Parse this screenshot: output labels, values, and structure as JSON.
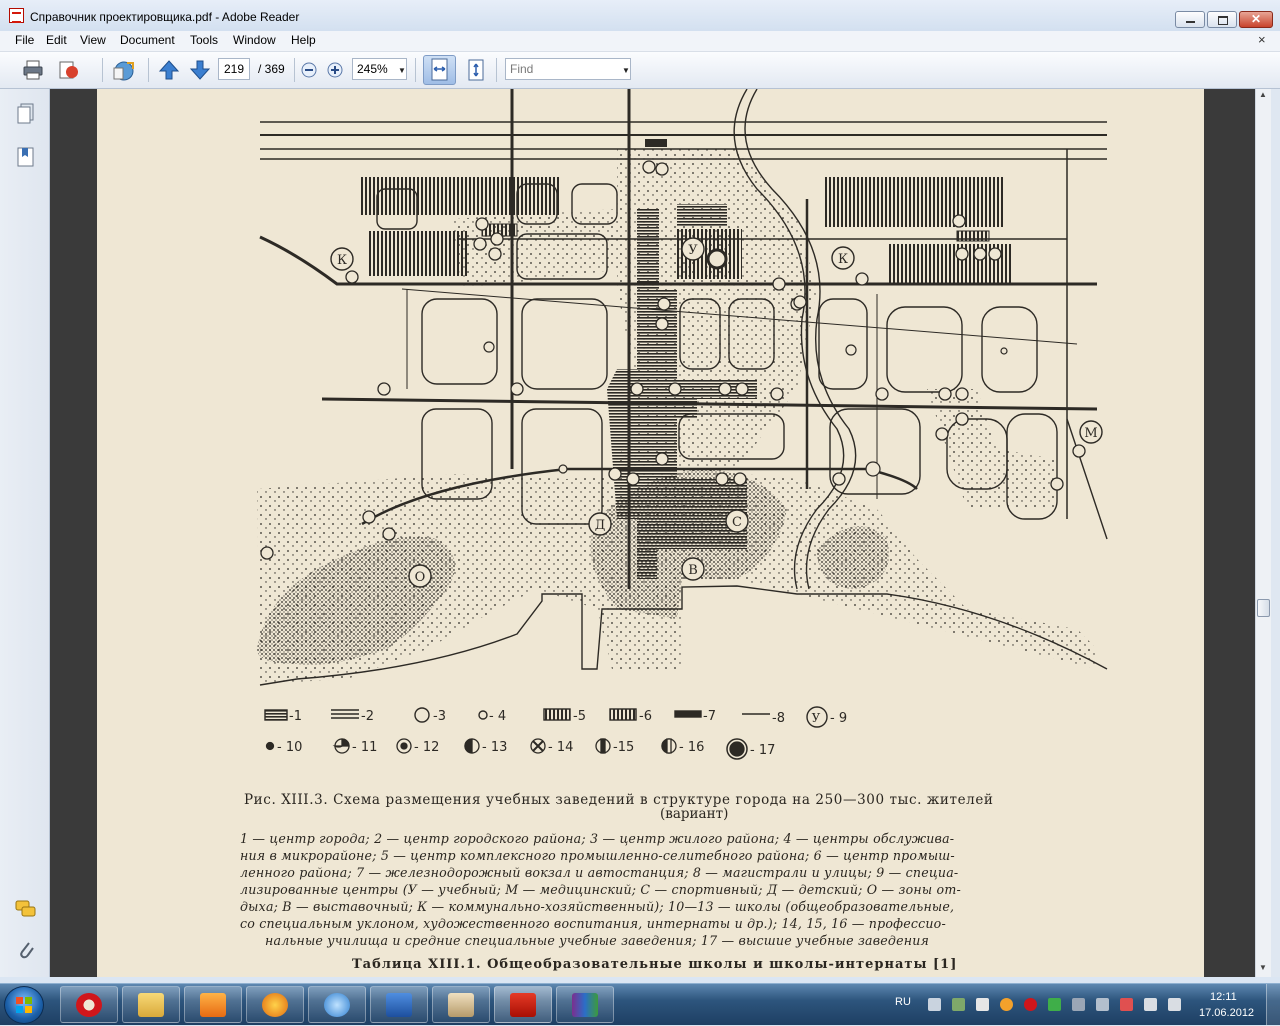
{
  "window": {
    "title": "Справочник проектировщика.pdf - Adobe Reader"
  },
  "menu": {
    "items": [
      "File",
      "Edit",
      "View",
      "Document",
      "Tools",
      "Window",
      "Help"
    ],
    "close_glyph": "×"
  },
  "toolbar": {
    "page_number": "219",
    "page_count": "/  369",
    "zoom": "245%",
    "find_placeholder": "Find"
  },
  "figure": {
    "legend": [
      "-1",
      "-2",
      "-3",
      "- 4",
      "-5",
      "-6",
      "-7",
      "-8",
      "- 9",
      "- 10",
      "- 11",
      "- 12",
      "- 13",
      "- 14",
      "-15",
      "- 16",
      "- 17"
    ],
    "map_letters": [
      "К",
      "К",
      "У",
      "М",
      "Д",
      "С",
      "В",
      "О"
    ],
    "title_line_1": "Рис. XIII.3. Схема размещения учебных заведений в структуре города на 250—300 тыс. жителей",
    "title_line_2": "(вариант)",
    "caption_lines": [
      "1 — центр города; 2 — центр городского района; 3 — центр жилого района; 4 — центры обслужива-",
      "ния в микрорайоне; 5 — центр комплексного промышленно-селитебного района; 6 — центр промыш-",
      "ленного района; 7 — железнодорожный вокзал и автостанция; 8 — магистрали и улицы; 9 — специа-",
      "лизированные центры (У — учебный; М — медицинский; С — спортивный; Д — детский; О — зоны от-",
      "дыха; В — выставочный; К — коммунально-хозяйственный); 10—13 — школы (общеобразовательные,",
      "со специальным уклоном, художественного воспитания, интернаты и др.); 14, 15, 16 — профессио-",
      "нальные училища и средние специальные учебные заведения; 17 — высшие учебные заведения"
    ],
    "table_title": "Таблица XIII.1. Общеобразовательные школы и школы-интернаты [1]"
  },
  "taskbar": {
    "apps": [
      "opera",
      "explorer",
      "media-player",
      "firefox-like",
      "mail",
      "word",
      "unknown",
      "adobe-reader",
      "winrar"
    ],
    "language": "RU",
    "time": "12:11",
    "date": "17.06.2012"
  },
  "colors": {
    "page_background": "#efe7d4",
    "document_background": "#3a3a3a",
    "ink": "#2a2620"
  }
}
